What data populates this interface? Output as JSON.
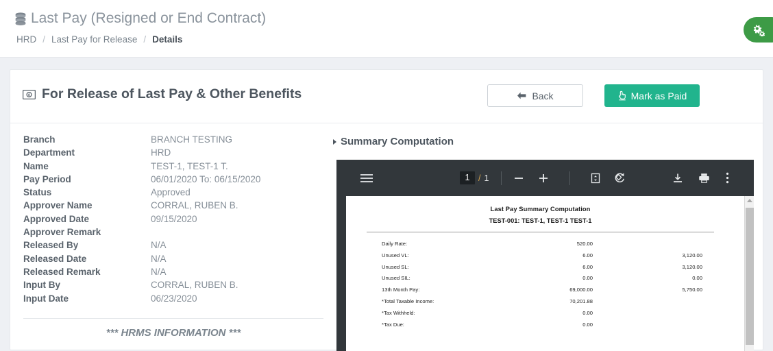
{
  "header": {
    "title": "Last Pay (Resigned or End Contract)",
    "title_icon": "database-icon",
    "breadcrumb": [
      {
        "label": "HRD"
      },
      {
        "label": "Last Pay for Release"
      },
      {
        "label": "Details"
      }
    ],
    "breadcrumb_separator": "/",
    "fab_icon": "gears-icon"
  },
  "card": {
    "title": "For Release of Last Pay & Other Benefits",
    "title_icon": "money-bill-icon",
    "back_label": "Back",
    "back_icon": "arrow-left-icon",
    "mark_paid_label": "Mark as Paid",
    "mark_paid_icon": "hand-pointer-icon"
  },
  "details": [
    {
      "label": "Branch",
      "value": "BRANCH TESTING"
    },
    {
      "label": "Department",
      "value": "HRD"
    },
    {
      "label": "Name",
      "value": "TEST-1, TEST-1 T."
    },
    {
      "label": "Pay Period",
      "value": "06/01/2020 To: 06/15/2020"
    },
    {
      "label": "Status",
      "value": "Approved"
    },
    {
      "label": "Approver Name",
      "value": "CORRAL, RUBEN B."
    },
    {
      "label": "Approved Date",
      "value": "09/15/2020"
    },
    {
      "label": "Approver Remark",
      "value": ""
    },
    {
      "label": "Released By",
      "value": "N/A"
    },
    {
      "label": "Released Date",
      "value": "N/A"
    },
    {
      "label": "Released Remark",
      "value": "N/A"
    },
    {
      "label": "Input By",
      "value": "CORRAL, RUBEN B."
    },
    {
      "label": "Input Date",
      "value": "06/23/2020"
    }
  ],
  "hrms_note": "*** HRMS INFORMATION ***",
  "summary": {
    "section_title": "Summary Computation"
  },
  "pdf_viewer": {
    "toolbar": {
      "menu_icon": "hamburger-icon",
      "page_current": "1",
      "page_separator": "/",
      "page_total": "1",
      "zoom_out_icon": "minus-icon",
      "zoom_in_icon": "plus-icon",
      "fit_page_icon": "fit-page-icon",
      "rotate_icon": "rotate-icon",
      "download_icon": "download-icon",
      "print_icon": "print-icon",
      "more_icon": "more-vertical-icon"
    },
    "document": {
      "title": "Last Pay Summary Computation",
      "subtitle": "TEST-001: TEST-1, TEST-1 TEST-1",
      "rows": [
        {
          "label": "Daily Rate:",
          "col2": "520.00",
          "col3": ""
        },
        {
          "label": "Unused VL:",
          "col2": "6.00",
          "col3": "3,120.00"
        },
        {
          "label": "Unused SL:",
          "col2": "6.00",
          "col3": "3,120.00"
        },
        {
          "label": "Unused SIL:",
          "col2": "0.00",
          "col3": "0.00"
        },
        {
          "label": "13th Month Pay:",
          "col2": "69,000.00",
          "col3": "5,750.00"
        },
        {
          "label": "*Total Taxable Income:",
          "col2": "70,201.88",
          "col3": ""
        },
        {
          "label": "*Tax Withheld:",
          "col2": "0.00",
          "col3": ""
        },
        {
          "label": "*Tax Due:",
          "col2": "0.00",
          "col3": ""
        }
      ]
    }
  },
  "colors": {
    "accent_green": "#3d9b46",
    "accent_teal": "#21b48d",
    "toolbar_dark": "#32373b"
  }
}
